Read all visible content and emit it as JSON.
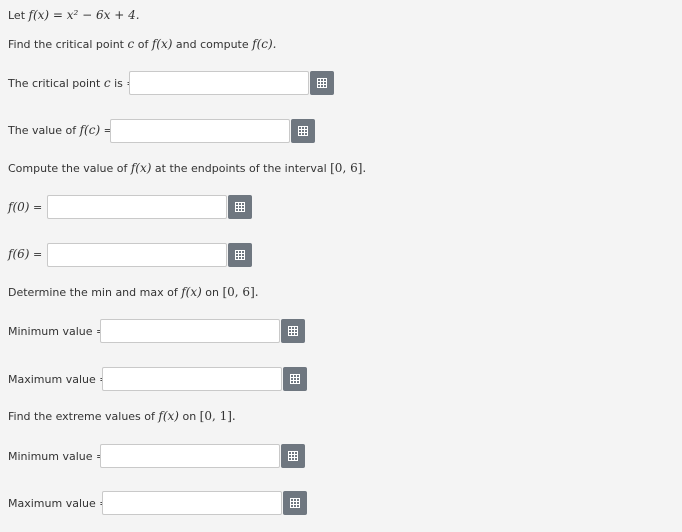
{
  "problem": {
    "intro_prefix": "Let ",
    "function_def": "f(x) = x² − 6x + 4.",
    "task1_prefix": "Find the critical point ",
    "task1_c": "c",
    "task1_mid": " of ",
    "task1_fx": "f(x)",
    "task1_mid2": " and compute ",
    "task1_fc": "f(c).",
    "critical_label_prefix": "The critical point ",
    "critical_label_c": "c",
    "critical_label_suffix": " is =",
    "fc_label_prefix": "The value of ",
    "fc_label_math": "f(c)",
    "fc_label_suffix": " =",
    "task2_prefix": "Compute the value of ",
    "task2_fx": "f(x)",
    "task2_mid": " at the endpoints of the interval ",
    "task2_interval": "[0, 6].",
    "f0_label_math": "f(0)",
    "f0_label_suffix": " =",
    "f6_label_math": "f(6)",
    "f6_label_suffix": " =",
    "task3_prefix": "Determine the min and max of ",
    "task3_fx": "f(x)",
    "task3_mid": " on ",
    "task3_interval": "[0, 6].",
    "min_label_1": "Minimum value =",
    "max_label_1": "Maximum value =",
    "task4_prefix": "Find the extreme values of ",
    "task4_fx": "f(x)",
    "task4_mid": " on ",
    "task4_interval": "[0, 1].",
    "min_label_2": "Minimum value =",
    "max_label_2": "Maximum value ="
  },
  "inputs": {
    "critical_point": "",
    "f_of_c": "",
    "f_of_0": "",
    "f_of_6": "",
    "min_1": "",
    "max_1": "",
    "min_2": "",
    "max_2": ""
  },
  "icons": {
    "keyboard_button": "math-keyboard-icon"
  },
  "colors": {
    "background": "#f4f4f4",
    "button": "#6f7780",
    "field_border": "#c9c9c9"
  }
}
